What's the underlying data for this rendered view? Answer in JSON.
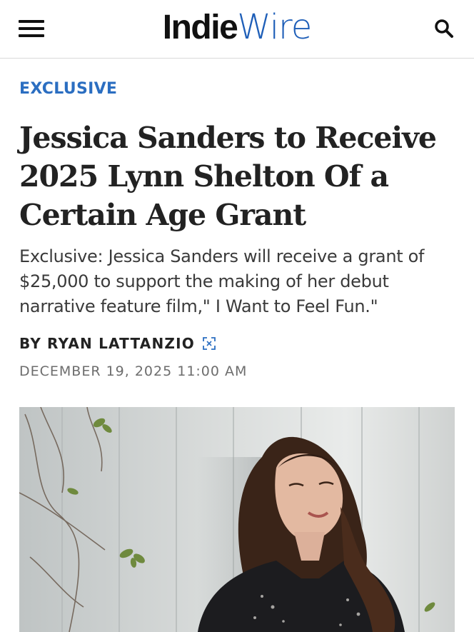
{
  "header": {
    "logo_part1": "Indie",
    "logo_part2": "Wire",
    "menu_icon": "hamburger-menu-icon",
    "search_icon": "search-icon"
  },
  "article": {
    "kicker": "EXCLUSIVE",
    "headline": "Jessica Sanders to Receive 2025 Lynn Shelton Of a Certain Age Grant",
    "dek": "Exclusive: Jessica Sanders will receive a grant of $25,000 to support the making of her debut narrative feature film,\" I Want to Feel Fun.\"",
    "byline_prefix": "BY",
    "author": "RYAN LATTANZIO",
    "author_badge_icon": "expand-icon",
    "date": "DECEMBER 19, 2025 11:00 AM"
  },
  "colors": {
    "accent_blue": "#2b6ec1",
    "logo_blue": "#1f5fb8",
    "text_dark": "#222222",
    "text_gray": "#6d6d6d"
  }
}
